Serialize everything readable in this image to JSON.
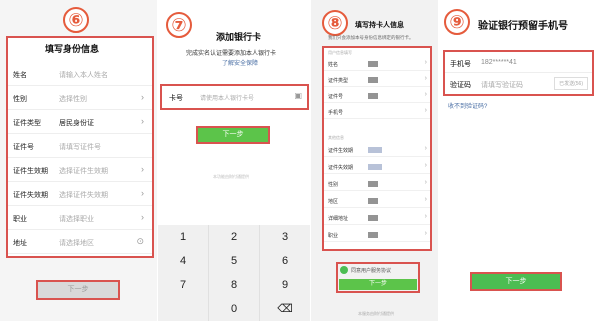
{
  "steps": {
    "s1": "⑥",
    "s2": "⑦",
    "s3": "⑧",
    "s4": "⑨"
  },
  "panel1": {
    "title": "填写身份信息",
    "rows": [
      {
        "label": "姓名",
        "value": "请输入本人姓名",
        "dark": false,
        "chevron": false
      },
      {
        "label": "性别",
        "value": "选择性别",
        "dark": false,
        "chevron": true
      },
      {
        "label": "证件类型",
        "value": "居民身份证",
        "dark": true,
        "chevron": true
      },
      {
        "label": "证件号",
        "value": "请填写证件号",
        "dark": false,
        "chevron": false
      },
      {
        "label": "证件生效期",
        "value": "选择证件生效期",
        "dark": false,
        "chevron": true
      },
      {
        "label": "证件失效期",
        "value": "选择证件失效期",
        "dark": false,
        "chevron": true
      },
      {
        "label": "职业",
        "value": "请选择职业",
        "dark": false,
        "chevron": true
      },
      {
        "label": "地址",
        "value": "请选择地区",
        "dark": false,
        "chevron": false
      }
    ],
    "next_button": "下一步"
  },
  "panel2": {
    "title": "添加银行卡",
    "subtitle": "完成实名认证需要添加本人银行卡",
    "link": "了解安全保障",
    "card_label": "卡号",
    "card_placeholder": "请使用本人银行卡号",
    "next_button": "下一步",
    "footer_hint": "本功能由财付通提供",
    "keys": [
      "1",
      "2",
      "3",
      "4",
      "5",
      "6",
      "7",
      "8",
      "9",
      "0",
      "⌫"
    ]
  },
  "panel3": {
    "title": "填写持卡人信息",
    "subtitle": "我们只会添加本号身份信息绑定的银行卡。",
    "section1": "用户信息填写",
    "section2": "其他信息",
    "rows": [
      "姓名",
      "证件类型",
      "证件号",
      "手机号",
      "证件生效期",
      "证件失效期",
      "性别",
      "地区",
      "详细地址",
      "职业"
    ],
    "agree": "同意用户服务协议",
    "next_button": "下一步",
    "footer_hint": "本服务由财付通提供"
  },
  "panel4": {
    "title": "验证银行预留手机号",
    "phone_label": "手机号",
    "phone_value": "182******41",
    "code_label": "验证码",
    "code_placeholder": "请填写验证码",
    "code_button": "已发送(56)",
    "no_code": "收不到验证码?",
    "next_button": "下一步"
  }
}
